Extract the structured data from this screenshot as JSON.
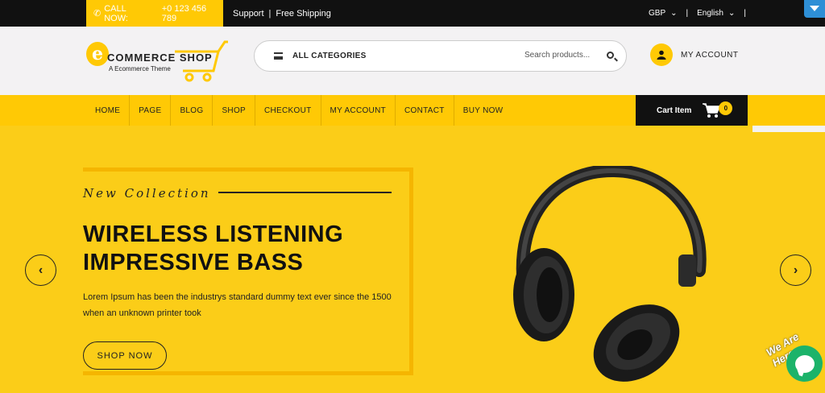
{
  "topbar": {
    "call_label": "CALL NOW:",
    "call_number": "+0 123 456 789",
    "support": "Support",
    "shipping": "Free Shipping",
    "currency": "GBP",
    "language": "English"
  },
  "header": {
    "logo_letter": "e",
    "logo_name": "COMMERCE SHOP",
    "logo_tagline": "A Ecommerce Theme",
    "search": {
      "category": "ALL CATEGORIES",
      "placeholder": "Search products..."
    },
    "account_label": "MY ACCOUNT"
  },
  "nav": {
    "items": [
      "HOME",
      "PAGE",
      "BLOG",
      "SHOP",
      "CHECKOUT",
      "MY ACCOUNT",
      "CONTACT",
      "BUY NOW"
    ],
    "cart_label": "Cart Item",
    "cart_count": "0"
  },
  "hero": {
    "subtitle": "New Collection",
    "headline_line1": "WIRELESS LISTENING",
    "headline_line2": "IMPRESSIVE BASS",
    "description": "Lorem Ipsum has been the industrys standard dummy text ever since the 1500 when an unknown printer took",
    "button": "SHOP NOW",
    "prev": "‹",
    "next": "›"
  },
  "chat": {
    "tagline": "We Are Here"
  },
  "colors": {
    "accent": "#ffc905",
    "dark": "#111111",
    "hero_bg": "#fbcd18",
    "chat": "#1cb36a"
  }
}
